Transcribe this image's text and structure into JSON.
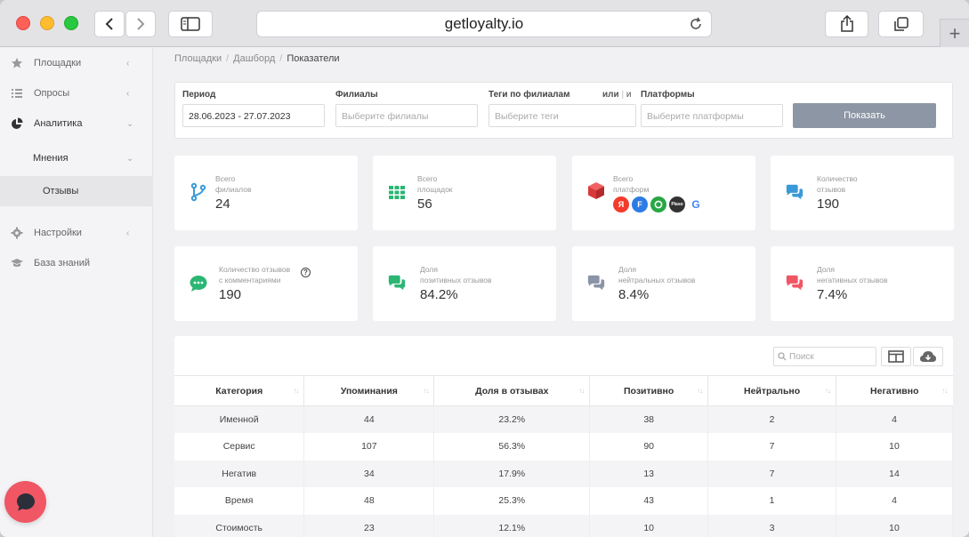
{
  "browser": {
    "url": "getloyalty.io"
  },
  "sidebar": {
    "items": [
      {
        "label": "Площадки",
        "icon": "star-icon"
      },
      {
        "label": "Опросы",
        "icon": "list-icon"
      },
      {
        "label": "Аналитика",
        "icon": "pie-chart-icon"
      },
      {
        "label": "Мнения"
      },
      {
        "label": "Отзывы"
      },
      {
        "label": "Настройки",
        "icon": "gear-icon"
      },
      {
        "label": "База знаний",
        "icon": "graduation-cap-icon"
      }
    ]
  },
  "breadcrumb": {
    "items": [
      "Площадки",
      "Дашборд",
      "Показатели"
    ]
  },
  "filters": {
    "period_label": "Период",
    "period_value": "28.06.2023 - 27.07.2023",
    "branches_label": "Филиалы",
    "branches_placeholder": "Выберите филиалы",
    "tags_label": "Теги по филиалам",
    "or_label": "или",
    "and_label": "и",
    "tags_placeholder": "Выберите теги",
    "platforms_label": "Платформы",
    "platforms_placeholder": "Выберите платформы",
    "show_button": "Показать"
  },
  "cards": [
    {
      "label1": "Всего",
      "label2": "филиалов",
      "value": "24",
      "icon": "branch-icon",
      "color": "#3a9ad9"
    },
    {
      "label1": "Всего",
      "label2": "площадок",
      "value": "56",
      "icon": "grid-icon",
      "color": "#2bb673"
    },
    {
      "label1": "Всего",
      "label2": "платформ",
      "icon": "cube-icon",
      "color": "#e64545",
      "platforms": [
        {
          "name": "yandex-icon",
          "glyph": "Я",
          "color": "#f33a2b"
        },
        {
          "name": "flamp-icon",
          "glyph": "F",
          "color": "#2d7be5"
        },
        {
          "name": "2gis-icon",
          "glyph": "",
          "color": "#28a745"
        },
        {
          "name": "prodoctorov-icon",
          "glyph": "Plaso",
          "color": "#333333"
        },
        {
          "name": "google-icon",
          "glyph": "G",
          "color": "#ffffff"
        }
      ]
    },
    {
      "label1": "Количество",
      "label2": "отзывов",
      "value": "190",
      "icon": "chat-icon",
      "color": "#3a9ad9"
    },
    {
      "label1": "Количество отзывов",
      "label2": "с комментариями",
      "value": "190",
      "icon": "comment-dots-icon",
      "color": "#2bb673"
    },
    {
      "label1": "Доля",
      "label2": "позитивных отзывов",
      "value": "84.2%",
      "icon": "chat-icon",
      "color": "#2bb673"
    },
    {
      "label1": "Доля",
      "label2": "нейтральных отзывов",
      "value": "8.4%",
      "icon": "chat-icon",
      "color": "#8a94a6"
    },
    {
      "label1": "Доля",
      "label2": "негативных отзывов",
      "value": "7.4%",
      "icon": "chat-icon",
      "color": "#f05664"
    }
  ],
  "table": {
    "search_placeholder": "Поиск",
    "columns": [
      "Категория",
      "Упоминания",
      "Доля в отзывах",
      "Позитивно",
      "Нейтрально",
      "Негативно"
    ],
    "rows": [
      [
        "Именной",
        "44",
        "23.2%",
        "38",
        "2",
        "4"
      ],
      [
        "Сервис",
        "107",
        "56.3%",
        "90",
        "7",
        "10"
      ],
      [
        "Негатив",
        "34",
        "17.9%",
        "13",
        "7",
        "14"
      ],
      [
        "Время",
        "48",
        "25.3%",
        "43",
        "1",
        "4"
      ],
      [
        "Стоимость",
        "23",
        "12.1%",
        "10",
        "3",
        "10"
      ]
    ]
  }
}
